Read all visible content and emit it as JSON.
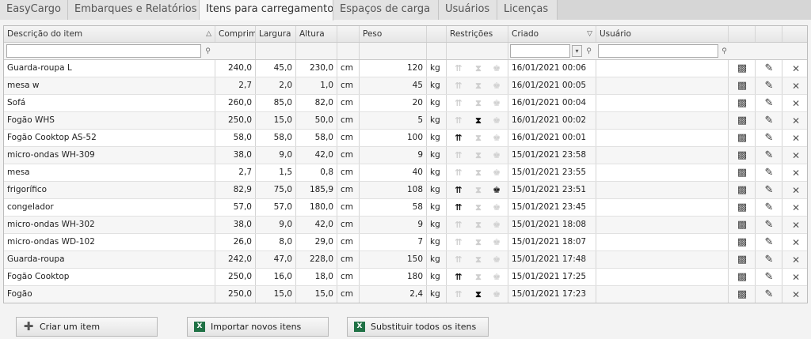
{
  "tabs": [
    "EasyCargo",
    "Embarques e Relatórios",
    "Itens para carregamento",
    "Espaços de carga",
    "Usuários",
    "Licenças"
  ],
  "active_tab": 2,
  "columns": {
    "description": "Descrição do item",
    "length": "Comprimento",
    "width": "Largura",
    "height": "Altura",
    "weight": "Peso",
    "restrictions": "Restrições",
    "created": "Criado",
    "user": "Usuário"
  },
  "sort_indicators": {
    "description": "△",
    "created": "▽"
  },
  "filters": {
    "description": "",
    "created": "",
    "user": ""
  },
  "rows": [
    {
      "name": "Guarda-roupa L",
      "l": "240,0",
      "w": "45,0",
      "h": "230,0",
      "u": "cm",
      "wt": "120",
      "wu": "kg",
      "r": [
        false,
        false,
        false
      ],
      "created": "16/01/2021 00:06",
      "user": ""
    },
    {
      "name": "mesa w",
      "l": "2,7",
      "w": "2,0",
      "h": "1,0",
      "u": "cm",
      "wt": "45",
      "wu": "kg",
      "r": [
        false,
        false,
        false
      ],
      "created": "16/01/2021 00:05",
      "user": ""
    },
    {
      "name": "Sofá",
      "l": "260,0",
      "w": "85,0",
      "h": "82,0",
      "u": "cm",
      "wt": "20",
      "wu": "kg",
      "r": [
        false,
        false,
        false
      ],
      "created": "16/01/2021 00:04",
      "user": ""
    },
    {
      "name": "Fogão WHS",
      "l": "250,0",
      "w": "15,0",
      "h": "50,0",
      "u": "cm",
      "wt": "5",
      "wu": "kg",
      "r": [
        false,
        true,
        false
      ],
      "created": "16/01/2021 00:02",
      "user": ""
    },
    {
      "name": "Fogão Cooktop AS-52",
      "l": "58,0",
      "w": "58,0",
      "h": "58,0",
      "u": "cm",
      "wt": "100",
      "wu": "kg",
      "r": [
        true,
        false,
        false
      ],
      "created": "16/01/2021 00:01",
      "user": ""
    },
    {
      "name": "micro-ondas WH-309",
      "l": "38,0",
      "w": "9,0",
      "h": "42,0",
      "u": "cm",
      "wt": "9",
      "wu": "kg",
      "r": [
        false,
        false,
        false
      ],
      "created": "15/01/2021 23:58",
      "user": ""
    },
    {
      "name": "mesa",
      "l": "2,7",
      "w": "1,5",
      "h": "0,8",
      "u": "cm",
      "wt": "40",
      "wu": "kg",
      "r": [
        false,
        false,
        false
      ],
      "created": "15/01/2021 23:55",
      "user": ""
    },
    {
      "name": "frigorífico",
      "l": "82,9",
      "w": "75,0",
      "h": "185,9",
      "u": "cm",
      "wt": "108",
      "wu": "kg",
      "r": [
        true,
        false,
        true
      ],
      "created": "15/01/2021 23:51",
      "user": ""
    },
    {
      "name": "congelador",
      "l": "57,0",
      "w": "57,0",
      "h": "180,0",
      "u": "cm",
      "wt": "58",
      "wu": "kg",
      "r": [
        true,
        false,
        false
      ],
      "created": "15/01/2021 23:45",
      "user": ""
    },
    {
      "name": "micro-ondas WH-302",
      "l": "38,0",
      "w": "9,0",
      "h": "42,0",
      "u": "cm",
      "wt": "9",
      "wu": "kg",
      "r": [
        false,
        false,
        false
      ],
      "created": "15/01/2021 18:08",
      "user": ""
    },
    {
      "name": "micro-ondas WD-102",
      "l": "26,0",
      "w": "8,0",
      "h": "29,0",
      "u": "cm",
      "wt": "7",
      "wu": "kg",
      "r": [
        false,
        false,
        false
      ],
      "created": "15/01/2021 18:07",
      "user": ""
    },
    {
      "name": "Guarda-roupa",
      "l": "242,0",
      "w": "47,0",
      "h": "228,0",
      "u": "cm",
      "wt": "150",
      "wu": "kg",
      "r": [
        false,
        false,
        false
      ],
      "created": "15/01/2021 17:48",
      "user": ""
    },
    {
      "name": "Fogão Cooktop",
      "l": "250,0",
      "w": "16,0",
      "h": "18,0",
      "u": "cm",
      "wt": "180",
      "wu": "kg",
      "r": [
        true,
        false,
        false
      ],
      "created": "15/01/2021 17:25",
      "user": ""
    },
    {
      "name": "Fogão",
      "l": "250,0",
      "w": "15,0",
      "h": "15,0",
      "u": "cm",
      "wt": "2,4",
      "wu": "kg",
      "r": [
        false,
        true,
        false
      ],
      "created": "15/01/2021 17:23",
      "user": ""
    }
  ],
  "restriction_icons": [
    "this-side-up-icon",
    "no-stacking-icon",
    "fragile-icon"
  ],
  "row_action_icons": [
    "package-icon",
    "edit-pencil-icon",
    "delete-x-icon"
  ],
  "buttons": {
    "create": "Criar um item",
    "import": "Importar novos itens",
    "replace": "Substituir todos os itens"
  },
  "colors": {
    "restriction_active": "#111111",
    "restriction_inactive": "#cfcfcf",
    "excel_green": "#1f7145"
  }
}
